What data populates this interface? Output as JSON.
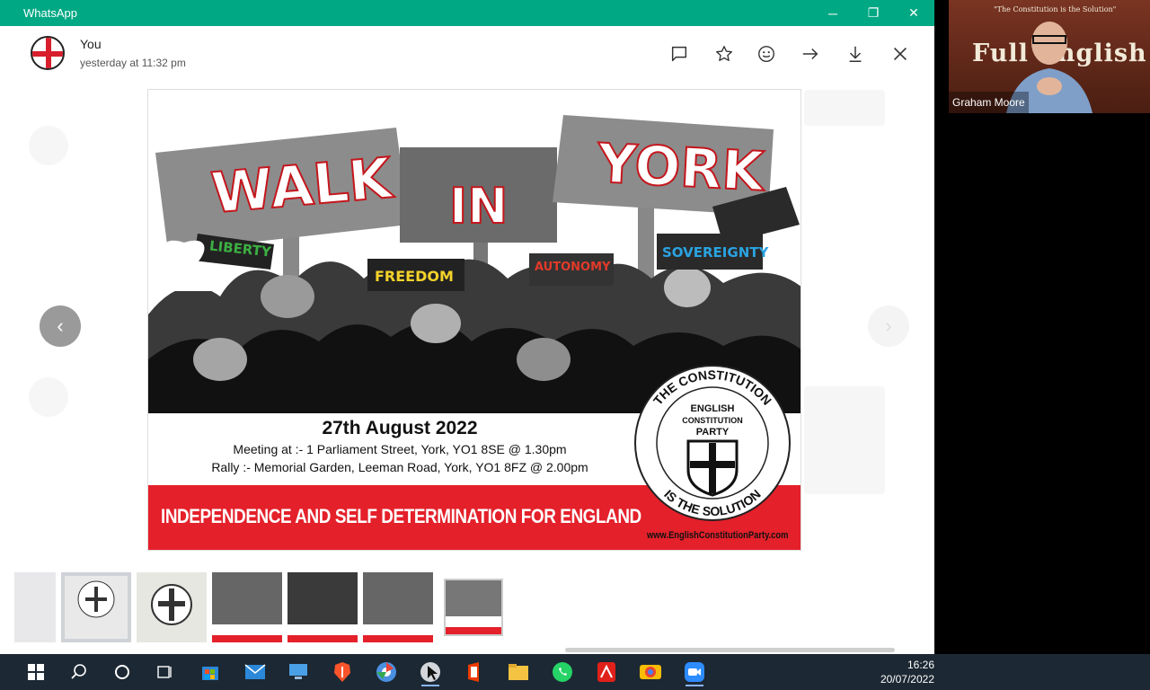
{
  "window": {
    "app_title": "WhatsApp",
    "controls": {
      "minimize": "─",
      "maximize": "❐",
      "close": "✕"
    }
  },
  "sender": {
    "name": "You",
    "time": "yesterday at 11:32 pm"
  },
  "toolbar": {
    "icons": [
      "message-icon",
      "star-icon",
      "emoji-icon",
      "forward-icon",
      "download-icon",
      "close-icon"
    ]
  },
  "poster": {
    "sign_walk": "WALK",
    "sign_in": "IN",
    "sign_york": "YORK",
    "sign_liberty": "LIBERTY",
    "sign_freedom": "FREEDOM",
    "sign_autonomy": "AUTONOMY",
    "sign_sovereignty": "SOVEREIGNTY",
    "date": "27th August 2022",
    "meeting": "Meeting at :- 1 Parliament Street, York, YO1 8SE @ 1.30pm",
    "rally": "Rally :- Memorial Garden, Leeman Road, York, YO1 8FZ @ 2.00pm",
    "banner": "INDEPENDENCE AND SELF DETERMINATION FOR ENGLAND",
    "seal_top": "THE CONSTITUTION",
    "seal_bottom": "IS THE SOLUTION",
    "seal_line1": "ENGLISH",
    "seal_line2": "CONSTITUTION",
    "seal_line3": "PARTY",
    "website": "www.EnglishConstitutionParty.com"
  },
  "navigation": {
    "prev": "‹",
    "next": "›"
  },
  "zoom": {
    "participant_name": "Graham Moore",
    "brand_text": "Full English",
    "quote": "\"The Constitution is the Solution\""
  },
  "taskbar": {
    "time": "16:26",
    "date": "20/07/2022",
    "icons": [
      "windows-start-icon",
      "search-icon",
      "cortana-icon",
      "task-view-icon",
      "microsoft-store-icon",
      "mail-icon",
      "computer-icon",
      "brave-icon",
      "chromium-icon",
      "cursor-app-icon",
      "office-icon",
      "file-explorer-icon",
      "whatsapp-icon",
      "acrobat-icon",
      "camera-app-icon",
      "zoom-icon"
    ]
  },
  "colors": {
    "whatsapp_green": "#00a884",
    "poster_red": "#e4202a",
    "taskbar": "#1c2833"
  }
}
